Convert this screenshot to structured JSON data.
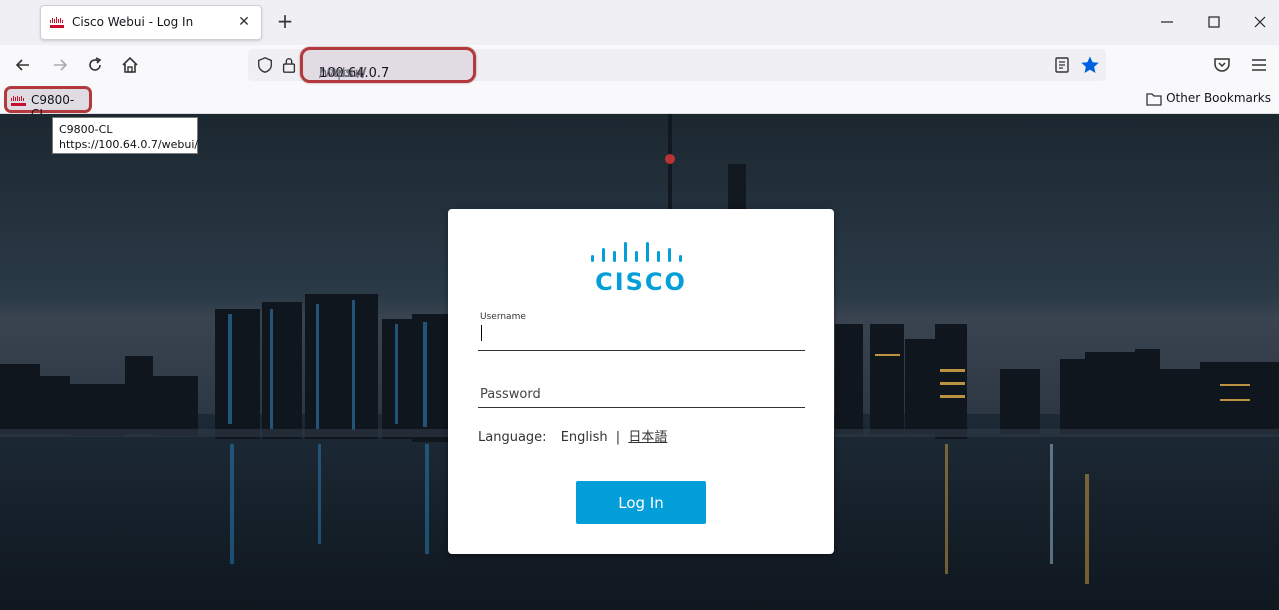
{
  "browser": {
    "tab": {
      "title": "Cisco Webui - Log In",
      "favicon": "cisco-favicon"
    },
    "url": {
      "protocol": "https://",
      "host": "100.64.0.7",
      "path": "/webui/"
    },
    "bookmarks": [
      {
        "label": "C9800-CL",
        "icon": "cisco-favicon"
      }
    ],
    "other_bookmarks_label": "Other Bookmarks",
    "tooltip": {
      "line1": "C9800-CL",
      "line2": "https://100.64.0.7/webui/"
    }
  },
  "login": {
    "logo_text": "CISCO",
    "username_label": "Username",
    "username_value": "",
    "password_placeholder": "Password",
    "language_label": "Language:",
    "lang_english": "English",
    "lang_sep": "|",
    "lang_japanese": "日本語",
    "login_button": "Log In"
  },
  "colors": {
    "cisco_blue": "#049fd9",
    "highlight_red": "#b23a3f"
  }
}
